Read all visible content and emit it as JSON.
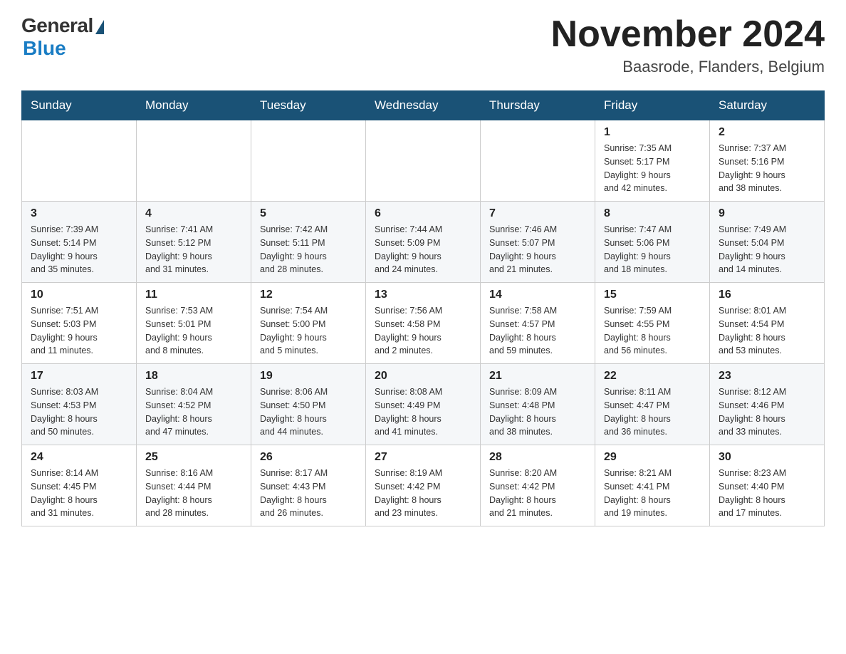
{
  "logo": {
    "general": "General",
    "blue": "Blue"
  },
  "title": "November 2024",
  "location": "Baasrode, Flanders, Belgium",
  "days_of_week": [
    "Sunday",
    "Monday",
    "Tuesday",
    "Wednesday",
    "Thursday",
    "Friday",
    "Saturday"
  ],
  "weeks": [
    [
      {
        "day": "",
        "info": ""
      },
      {
        "day": "",
        "info": ""
      },
      {
        "day": "",
        "info": ""
      },
      {
        "day": "",
        "info": ""
      },
      {
        "day": "",
        "info": ""
      },
      {
        "day": "1",
        "info": "Sunrise: 7:35 AM\nSunset: 5:17 PM\nDaylight: 9 hours\nand 42 minutes."
      },
      {
        "day": "2",
        "info": "Sunrise: 7:37 AM\nSunset: 5:16 PM\nDaylight: 9 hours\nand 38 minutes."
      }
    ],
    [
      {
        "day": "3",
        "info": "Sunrise: 7:39 AM\nSunset: 5:14 PM\nDaylight: 9 hours\nand 35 minutes."
      },
      {
        "day": "4",
        "info": "Sunrise: 7:41 AM\nSunset: 5:12 PM\nDaylight: 9 hours\nand 31 minutes."
      },
      {
        "day": "5",
        "info": "Sunrise: 7:42 AM\nSunset: 5:11 PM\nDaylight: 9 hours\nand 28 minutes."
      },
      {
        "day": "6",
        "info": "Sunrise: 7:44 AM\nSunset: 5:09 PM\nDaylight: 9 hours\nand 24 minutes."
      },
      {
        "day": "7",
        "info": "Sunrise: 7:46 AM\nSunset: 5:07 PM\nDaylight: 9 hours\nand 21 minutes."
      },
      {
        "day": "8",
        "info": "Sunrise: 7:47 AM\nSunset: 5:06 PM\nDaylight: 9 hours\nand 18 minutes."
      },
      {
        "day": "9",
        "info": "Sunrise: 7:49 AM\nSunset: 5:04 PM\nDaylight: 9 hours\nand 14 minutes."
      }
    ],
    [
      {
        "day": "10",
        "info": "Sunrise: 7:51 AM\nSunset: 5:03 PM\nDaylight: 9 hours\nand 11 minutes."
      },
      {
        "day": "11",
        "info": "Sunrise: 7:53 AM\nSunset: 5:01 PM\nDaylight: 9 hours\nand 8 minutes."
      },
      {
        "day": "12",
        "info": "Sunrise: 7:54 AM\nSunset: 5:00 PM\nDaylight: 9 hours\nand 5 minutes."
      },
      {
        "day": "13",
        "info": "Sunrise: 7:56 AM\nSunset: 4:58 PM\nDaylight: 9 hours\nand 2 minutes."
      },
      {
        "day": "14",
        "info": "Sunrise: 7:58 AM\nSunset: 4:57 PM\nDaylight: 8 hours\nand 59 minutes."
      },
      {
        "day": "15",
        "info": "Sunrise: 7:59 AM\nSunset: 4:55 PM\nDaylight: 8 hours\nand 56 minutes."
      },
      {
        "day": "16",
        "info": "Sunrise: 8:01 AM\nSunset: 4:54 PM\nDaylight: 8 hours\nand 53 minutes."
      }
    ],
    [
      {
        "day": "17",
        "info": "Sunrise: 8:03 AM\nSunset: 4:53 PM\nDaylight: 8 hours\nand 50 minutes."
      },
      {
        "day": "18",
        "info": "Sunrise: 8:04 AM\nSunset: 4:52 PM\nDaylight: 8 hours\nand 47 minutes."
      },
      {
        "day": "19",
        "info": "Sunrise: 8:06 AM\nSunset: 4:50 PM\nDaylight: 8 hours\nand 44 minutes."
      },
      {
        "day": "20",
        "info": "Sunrise: 8:08 AM\nSunset: 4:49 PM\nDaylight: 8 hours\nand 41 minutes."
      },
      {
        "day": "21",
        "info": "Sunrise: 8:09 AM\nSunset: 4:48 PM\nDaylight: 8 hours\nand 38 minutes."
      },
      {
        "day": "22",
        "info": "Sunrise: 8:11 AM\nSunset: 4:47 PM\nDaylight: 8 hours\nand 36 minutes."
      },
      {
        "day": "23",
        "info": "Sunrise: 8:12 AM\nSunset: 4:46 PM\nDaylight: 8 hours\nand 33 minutes."
      }
    ],
    [
      {
        "day": "24",
        "info": "Sunrise: 8:14 AM\nSunset: 4:45 PM\nDaylight: 8 hours\nand 31 minutes."
      },
      {
        "day": "25",
        "info": "Sunrise: 8:16 AM\nSunset: 4:44 PM\nDaylight: 8 hours\nand 28 minutes."
      },
      {
        "day": "26",
        "info": "Sunrise: 8:17 AM\nSunset: 4:43 PM\nDaylight: 8 hours\nand 26 minutes."
      },
      {
        "day": "27",
        "info": "Sunrise: 8:19 AM\nSunset: 4:42 PM\nDaylight: 8 hours\nand 23 minutes."
      },
      {
        "day": "28",
        "info": "Sunrise: 8:20 AM\nSunset: 4:42 PM\nDaylight: 8 hours\nand 21 minutes."
      },
      {
        "day": "29",
        "info": "Sunrise: 8:21 AM\nSunset: 4:41 PM\nDaylight: 8 hours\nand 19 minutes."
      },
      {
        "day": "30",
        "info": "Sunrise: 8:23 AM\nSunset: 4:40 PM\nDaylight: 8 hours\nand 17 minutes."
      }
    ]
  ]
}
